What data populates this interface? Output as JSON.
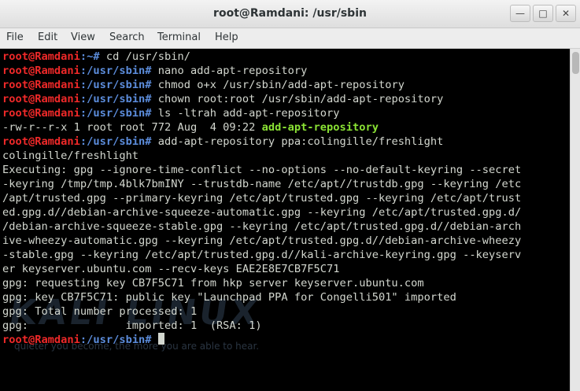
{
  "window": {
    "title": "root@Ramdani: /usr/sbin",
    "controls": [
      "minimize",
      "maximize",
      "close"
    ]
  },
  "menu": [
    "File",
    "Edit",
    "View",
    "Search",
    "Terminal",
    "Help"
  ],
  "colors": {
    "prompt_user": "#ef2929",
    "prompt_path": "#5c8ddc",
    "executable": "#8ae234",
    "background": "#000000"
  },
  "terminal": {
    "prompt_user": "root@Ramdani",
    "prompt_path_home": "~",
    "prompt_path": "/usr/sbin",
    "lines": [
      {
        "type": "cmd",
        "path": "~",
        "text": "cd /usr/sbin/"
      },
      {
        "type": "cmd",
        "path": "/usr/sbin",
        "text": "nano add-apt-repository"
      },
      {
        "type": "cmd",
        "path": "/usr/sbin",
        "text": "chmod o+x /usr/sbin/add-apt-repository"
      },
      {
        "type": "cmd",
        "path": "/usr/sbin",
        "text": "chown root:root /usr/sbin/add-apt-repository"
      },
      {
        "type": "cmd",
        "path": "/usr/sbin",
        "text": "ls -ltrah add-apt-repository"
      },
      {
        "type": "ls",
        "text": "-rw-r--r-x 1 root root 772 Aug  4 09:22 ",
        "file": "add-apt-repository"
      },
      {
        "type": "cmd",
        "path": "/usr/sbin",
        "text": "add-apt-repository ppa:colingille/freshlight"
      },
      {
        "type": "out",
        "text": "colingille/freshlight"
      },
      {
        "type": "out",
        "text": "Executing: gpg --ignore-time-conflict --no-options --no-default-keyring --secret"
      },
      {
        "type": "out",
        "text": "-keyring /tmp/tmp.4blk7bmINY --trustdb-name /etc/apt//trustdb.gpg --keyring /etc"
      },
      {
        "type": "out",
        "text": "/apt/trusted.gpg --primary-keyring /etc/apt/trusted.gpg --keyring /etc/apt/trust"
      },
      {
        "type": "out",
        "text": "ed.gpg.d//debian-archive-squeeze-automatic.gpg --keyring /etc/apt/trusted.gpg.d/"
      },
      {
        "type": "out",
        "text": "/debian-archive-squeeze-stable.gpg --keyring /etc/apt/trusted.gpg.d//debian-arch"
      },
      {
        "type": "out",
        "text": "ive-wheezy-automatic.gpg --keyring /etc/apt/trusted.gpg.d//debian-archive-wheezy"
      },
      {
        "type": "out",
        "text": "-stable.gpg --keyring /etc/apt/trusted.gpg.d//kali-archive-keyring.gpg --keyserv"
      },
      {
        "type": "out",
        "text": "er keyserver.ubuntu.com --recv-keys EAE2E8E7CB7F5C71"
      },
      {
        "type": "out",
        "text": "gpg: requesting key CB7F5C71 from hkp server keyserver.ubuntu.com"
      },
      {
        "type": "out",
        "text": "gpg: key CB7F5C71: public key \"Launchpad PPA for Congelli501\" imported"
      },
      {
        "type": "out",
        "text": "gpg: Total number processed: 1"
      },
      {
        "type": "out",
        "text": "gpg:               imported: 1  (RSA: 1)"
      },
      {
        "type": "cmd_cursor",
        "path": "/usr/sbin",
        "text": ""
      }
    ]
  },
  "watermark": {
    "logo": "KALI LINUX",
    "tagline": "quieter you become, the more you are able to hear."
  }
}
